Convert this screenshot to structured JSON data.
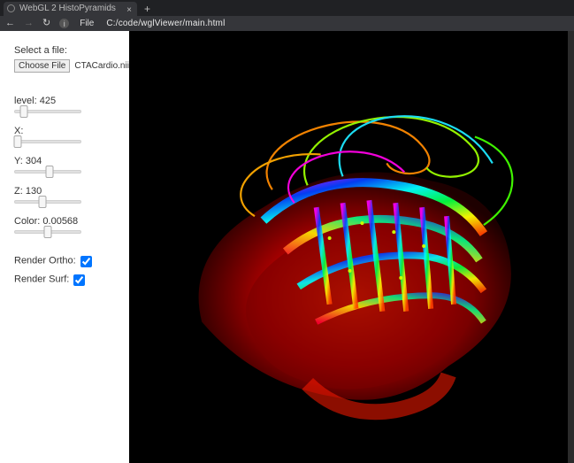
{
  "browser": {
    "tab_title": "WebGL 2 HistoPyramids",
    "url": "C:/code/wglViewer/main.html",
    "file_chip": "File"
  },
  "sidebar": {
    "select_label": "Select a file:",
    "choose_button": "Choose File",
    "chosen_file": "CTACardio.nii.gz",
    "controls": {
      "level": {
        "label": "level:",
        "value": "425",
        "pos": 15
      },
      "x": {
        "label": "X:",
        "value": "",
        "pos": 5
      },
      "y": {
        "label": "Y:",
        "value": "304",
        "pos": 52
      },
      "z": {
        "label": "Z:",
        "value": "130",
        "pos": 42
      },
      "color": {
        "label": "Color:",
        "value": "0.00568",
        "pos": 50
      }
    },
    "render_ortho_label": "Render Ortho:",
    "render_surf_label": "Render Surf:"
  }
}
